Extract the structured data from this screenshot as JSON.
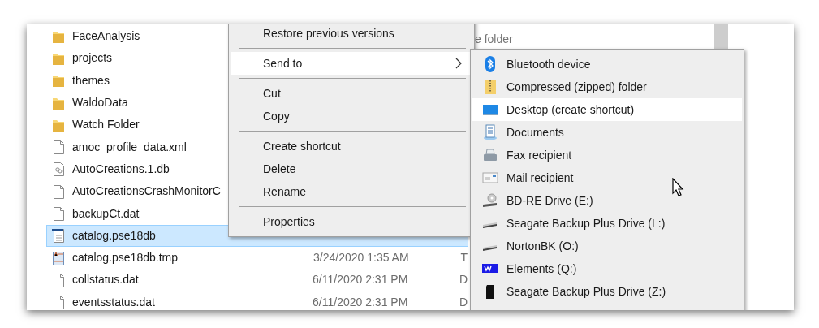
{
  "files": [
    {
      "name": "FaceAnalysis",
      "kind": "folder",
      "selected": false
    },
    {
      "name": "projects",
      "kind": "folder",
      "selected": false
    },
    {
      "name": "themes",
      "kind": "folder",
      "selected": false
    },
    {
      "name": "WaldoData",
      "kind": "folder",
      "selected": false
    },
    {
      "name": "Watch Folder",
      "kind": "folder",
      "selected": false
    },
    {
      "name": "amoc_profile_data.xml",
      "kind": "file",
      "selected": false
    },
    {
      "name": "AutoCreations.1.db",
      "kind": "db",
      "selected": false
    },
    {
      "name": "AutoCreationsCrashMonitorC",
      "kind": "file",
      "selected": false
    },
    {
      "name": "backupCt.dat",
      "kind": "file",
      "selected": false
    },
    {
      "name": "catalog.pse18db",
      "kind": "catalog",
      "selected": true
    },
    {
      "name": "catalog.pse18db.tmp",
      "kind": "tmp",
      "date": "3/24/2020 1:35 AM",
      "type": "T",
      "selected": false
    },
    {
      "name": "collstatus.dat",
      "kind": "file",
      "date": "6/11/2020 2:31 PM",
      "type": "D",
      "selected": false
    },
    {
      "name": "eventsstatus.dat",
      "kind": "file",
      "date": "6/11/2020 2:31 PM",
      "type": "D",
      "selected": false
    }
  ],
  "search": {
    "placeholder": "e folder"
  },
  "context_menu": [
    {
      "kind": "item",
      "label": "Restore previous versions",
      "selected": false
    },
    {
      "kind": "separator"
    },
    {
      "kind": "item",
      "label": "Send to",
      "submenu": true,
      "selected": true
    },
    {
      "kind": "separator"
    },
    {
      "kind": "item",
      "label": "Cut",
      "selected": false
    },
    {
      "kind": "item",
      "label": "Copy",
      "selected": false
    },
    {
      "kind": "separator"
    },
    {
      "kind": "item",
      "label": "Create shortcut",
      "selected": false
    },
    {
      "kind": "item",
      "label": "Delete",
      "selected": false
    },
    {
      "kind": "item",
      "label": "Rename",
      "selected": false
    },
    {
      "kind": "separator"
    },
    {
      "kind": "item",
      "label": "Properties",
      "selected": false
    }
  ],
  "send_to": [
    {
      "label": "Bluetooth device",
      "kind": "bluetooth",
      "selected": false
    },
    {
      "label": "Compressed (zipped) folder",
      "kind": "zip",
      "selected": false
    },
    {
      "label": "Desktop (create shortcut)",
      "kind": "desktop",
      "selected": true
    },
    {
      "label": "Documents",
      "kind": "documents",
      "selected": false
    },
    {
      "label": "Fax recipient",
      "kind": "fax",
      "selected": false
    },
    {
      "label": "Mail recipient",
      "kind": "mail",
      "selected": false
    },
    {
      "label": "BD-RE Drive (E:)",
      "kind": "disc",
      "selected": false
    },
    {
      "label": "Seagate Backup Plus Drive (L:)",
      "kind": "drive",
      "selected": false
    },
    {
      "label": "NortonBK (O:)",
      "kind": "drive",
      "selected": false
    },
    {
      "label": "Elements (Q:)",
      "kind": "wd",
      "selected": false
    },
    {
      "label": "Seagate Backup Plus Drive (Z:)",
      "kind": "tower",
      "selected": false
    }
  ]
}
